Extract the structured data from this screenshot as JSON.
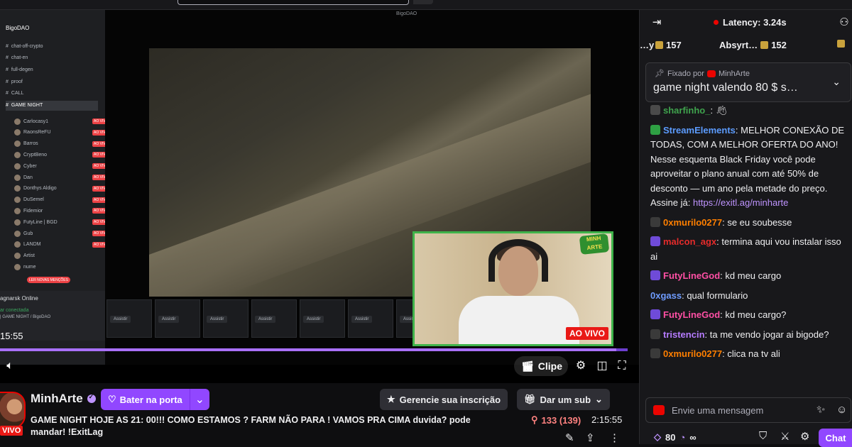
{
  "player": {
    "discord": {
      "server_name": "BigoDAO",
      "channels": [
        "chat-off-crypto",
        "chat-en",
        "full-degen",
        "proof",
        "CALL",
        "GAME NIGHT"
      ],
      "members": [
        "Carlocasy1",
        "RaonsReFU",
        "Barros",
        "CryptBeno",
        "Cyber",
        "Dan",
        "Donthys Aldigo",
        "DuSemel",
        "Fidemior",
        "FutyLine | BGD",
        "Gub",
        "LANDM",
        "Artist",
        "nume"
      ],
      "live_tag": "AO VIVO",
      "mentions_tag": "LER NOVAS MENÇÕES",
      "status_top": "agnarsk Online",
      "status_connected": "ar conectada",
      "status_channel": "| GAME NIGHT / BigoDAO",
      "watch_label": "Assistir"
    },
    "clock": "15:55",
    "progress": 0.982,
    "webcam_logo": "MINH ARTE",
    "live_badge": "AO VIVO",
    "clip_label": "Clipe"
  },
  "info": {
    "vivo_badge": "VIVO",
    "streamer_name": "MinhArte",
    "knock_label": "Bater na porta",
    "manage_sub_label": "Gerencie sua inscrição",
    "gift_sub_label": "Dar um sub",
    "title": "GAME NIGHT HOJE AS 21: 00!!! COMO ESTAMOS ? FARM NÃO PARA ! VAMOS PRA CIMA duvida? pode mandar! !ExitLag",
    "viewers": "133 (139)",
    "uptime": "2:15:55"
  },
  "chat": {
    "latency": "Latency: 3.24s",
    "gifters": [
      {
        "name": "…y",
        "count": ""
      },
      {
        "name": "",
        "count": "157"
      },
      {
        "name": "Absyrt…",
        "count": "152"
      }
    ],
    "pinned_by_label": "Fixado por",
    "pinned_by_user": "MinhArte",
    "pinned_message": "game night valendo 80 $ s…",
    "messages": [
      {
        "user": "sharfinho_",
        "color": "#3fa34d",
        "text": ""
      },
      {
        "user": "StreamElements",
        "color": "#5c9cff",
        "text": "MELHOR CONEXÃO DE TODAS, COM A MELHOR OFERTA DO ANO! Nesse esquenta Black Friday você pode aproveitar o plano anual com até 50% de desconto — um ano pela metade do preço. Assine já: ",
        "link": "https://exitl.ag/minharte"
      },
      {
        "user": "0xmurilo0277",
        "color": "#ff7f00",
        "text": "se eu soubesse"
      },
      {
        "user": "malcon_agx",
        "color": "#e52b2b",
        "text": "termina aqui vou instalar isso ai"
      },
      {
        "user": "FutyLineGod",
        "color": "#ff4fa5",
        "text": "kd meu cargo"
      },
      {
        "user": "0xgass",
        "color": "#6f9cff",
        "text": "qual formulario"
      },
      {
        "user": "FutyLineGod",
        "color": "#ff4fa5",
        "text": "kd meu cargo?"
      },
      {
        "user": "tristencin",
        "color": "#b67cff",
        "text": "ta me vendo jogar ai bigode?"
      },
      {
        "user": "0xmurilo0277",
        "color": "#ff7f00",
        "text": "clica na tv ali"
      }
    ],
    "input_placeholder": "Envie uma mensagem",
    "points": "80",
    "points_suffix": "∞",
    "chat_button": "Chat"
  }
}
